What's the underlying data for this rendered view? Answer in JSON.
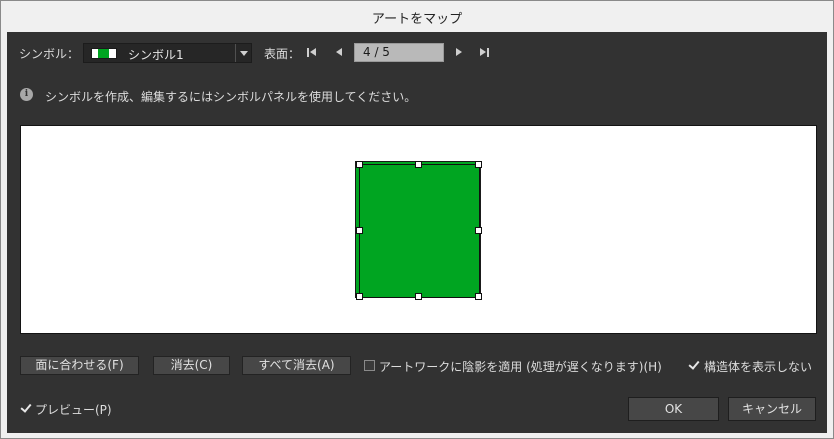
{
  "window": {
    "title": "アートをマップ"
  },
  "symbol": {
    "label": "シンボル：",
    "selected": "シンボル1"
  },
  "surface": {
    "label": "表面：",
    "page": "4 / 5"
  },
  "info": {
    "message": "シンボルを作成、編集するにはシンボルパネルを使用してください。"
  },
  "preview_art": {
    "fill": "#00a521"
  },
  "buttons": {
    "fit_face": "面に合わせる(F)",
    "clear": "消去(C)",
    "clear_all": "すべて消去(A)",
    "ok": "OK",
    "cancel": "キャンセル"
  },
  "options": {
    "shade_artwork": {
      "label": "アートワークに陰影を適用 (処理が遅くなります)(H)",
      "checked": false
    },
    "invisible_geometry": {
      "label": "構造体を表示しない",
      "checked": true
    },
    "preview": {
      "label": "プレビュー(P)",
      "checked": true
    }
  }
}
